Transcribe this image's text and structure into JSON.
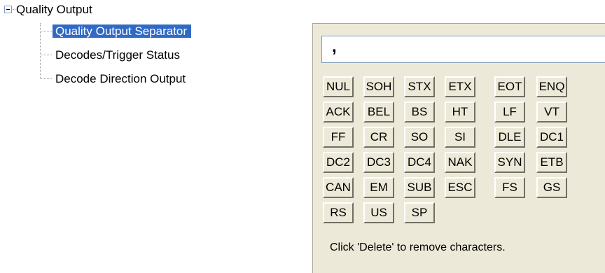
{
  "tree": {
    "root_label": "Quality Output",
    "items": [
      {
        "label": "Quality Output Separator",
        "selected": true
      },
      {
        "label": "Decodes/Trigger Status",
        "selected": false
      },
      {
        "label": "Decode Direction Output",
        "selected": false
      }
    ]
  },
  "panel": {
    "input_value": ",",
    "keys": [
      "NUL",
      "SOH",
      "STX",
      "ETX",
      "EOT",
      "ENQ",
      "ACK",
      "BEL",
      "BS",
      "HT",
      "LF",
      "VT",
      "FF",
      "CR",
      "SO",
      "SI",
      "DLE",
      "DC1",
      "DC2",
      "DC3",
      "DC4",
      "NAK",
      "SYN",
      "ETB",
      "CAN",
      "EM",
      "SUB",
      "ESC",
      "FS",
      "GS",
      "RS",
      "US",
      "SP"
    ],
    "hint": "Click 'Delete' to remove characters."
  }
}
